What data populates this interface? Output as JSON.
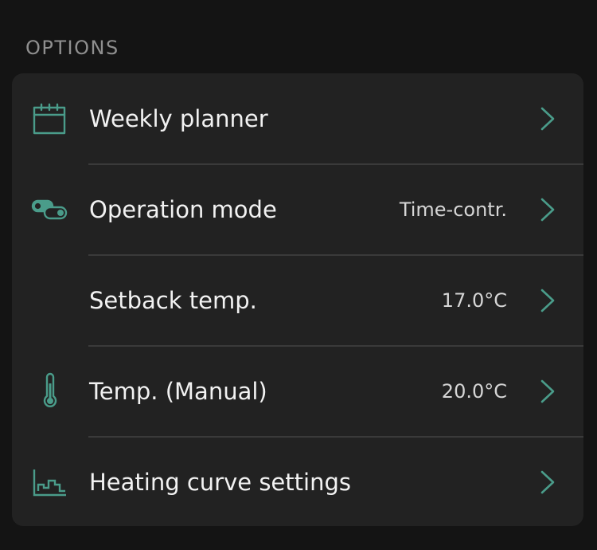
{
  "section_title": "OPTIONS",
  "accent_color": "#4a9c8a",
  "items": [
    {
      "label": "Weekly planner",
      "value": "",
      "icon": "calendar-icon"
    },
    {
      "label": "Operation mode",
      "value": "Time-contr.",
      "icon": "toggle-icon"
    },
    {
      "label": "Setback temp.",
      "value": "17.0°C",
      "icon": "moon-icon"
    },
    {
      "label": "Temp. (Manual)",
      "value": "20.0°C",
      "icon": "thermometer-icon"
    },
    {
      "label": "Heating curve settings",
      "value": "",
      "icon": "heating-curve-icon"
    }
  ]
}
